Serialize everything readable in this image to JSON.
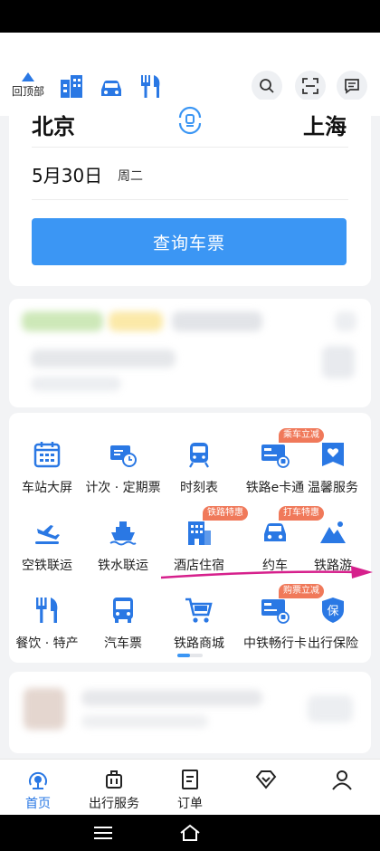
{
  "topbar": {
    "back_to_top": "回顶部"
  },
  "search": {
    "from_city": "北京",
    "to_city": "上海",
    "date": "5月30日",
    "weekday": "周二",
    "query_button": "查询车票"
  },
  "services": {
    "items": [
      {
        "label": "车站大屏",
        "icon": "station-screen-icon",
        "badge": ""
      },
      {
        "label": "计次 · 定期票",
        "icon": "ticket-clock-icon",
        "badge": ""
      },
      {
        "label": "时刻表",
        "icon": "train-icon",
        "badge": ""
      },
      {
        "label": "铁路e卡通",
        "icon": "card-icon",
        "badge": "乘车立减"
      },
      {
        "label": "温馨服务",
        "icon": "heart-service-icon",
        "badge": ""
      },
      {
        "label": "空铁联运",
        "icon": "air-rail-icon",
        "badge": ""
      },
      {
        "label": "铁水联运",
        "icon": "ship-icon",
        "badge": ""
      },
      {
        "label": "酒店住宿",
        "icon": "hotel-icon",
        "badge": "铁路特惠"
      },
      {
        "label": "约车",
        "icon": "car-icon",
        "badge": "打车特惠"
      },
      {
        "label": "铁路游",
        "icon": "mountain-icon",
        "badge": ""
      },
      {
        "label": "餐饮 · 特产",
        "icon": "fork-knife-icon",
        "badge": ""
      },
      {
        "label": "汽车票",
        "icon": "bus-icon",
        "badge": ""
      },
      {
        "label": "铁路商城",
        "icon": "cart-icon",
        "badge": ""
      },
      {
        "label": "中铁畅行卡",
        "icon": "train-card-icon",
        "badge": "购票立减"
      },
      {
        "label": "出行保险",
        "icon": "insurance-shield-icon",
        "badge": ""
      }
    ],
    "insurance_glyph": "保",
    "page_indicator": {
      "current": 1,
      "total": 2
    }
  },
  "tabs": [
    {
      "label": "首页",
      "icon": "home-icon",
      "active": true
    },
    {
      "label": "出行服务",
      "icon": "luggage-icon",
      "active": false
    },
    {
      "label": "订单",
      "icon": "order-icon",
      "active": false
    },
    {
      "label": "",
      "icon": "diamond-icon",
      "active": false
    },
    {
      "label": "",
      "icon": "user-icon",
      "active": false
    }
  ],
  "colors": {
    "accent": "#2a78e4",
    "button": "#3b96f4",
    "badge": "#f0795a",
    "arrow": "#d6208c"
  }
}
